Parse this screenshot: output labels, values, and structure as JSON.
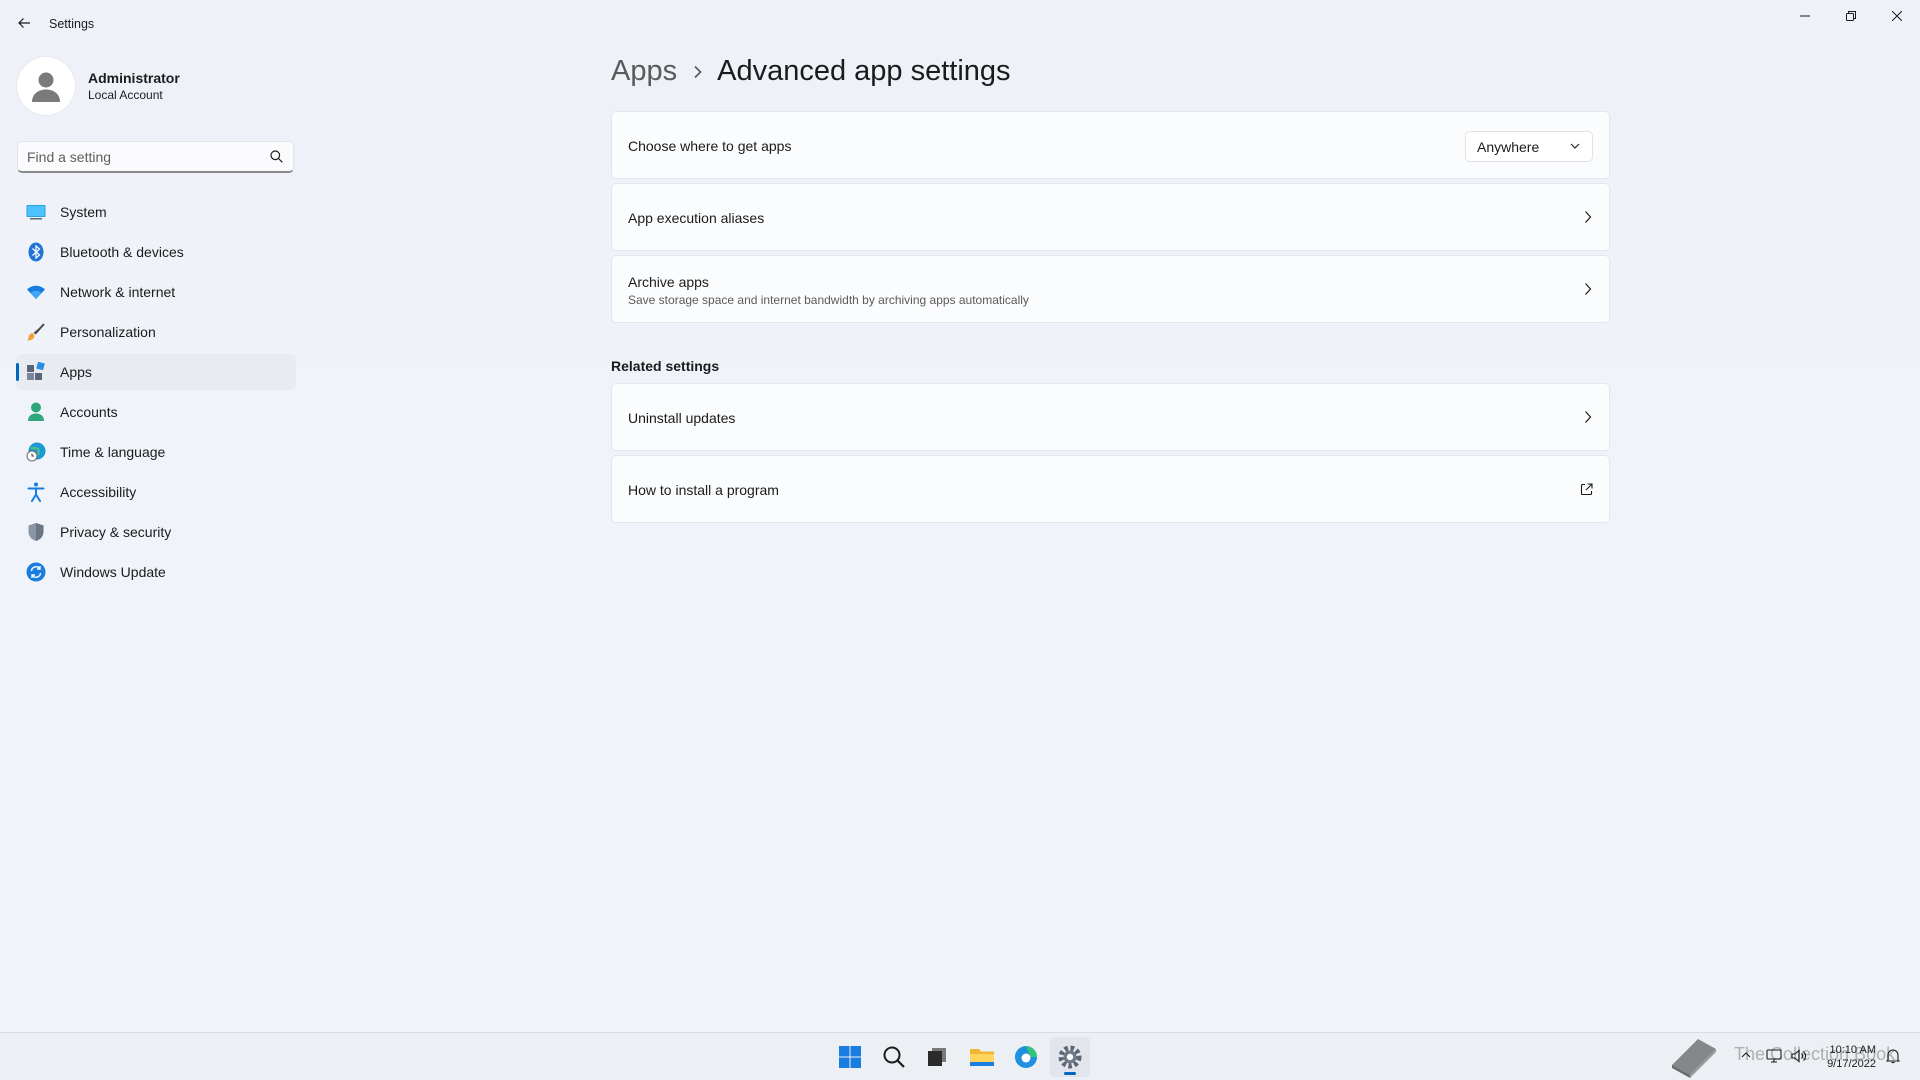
{
  "window": {
    "title": "Settings"
  },
  "profile": {
    "name": "Administrator",
    "account_type": "Local Account"
  },
  "search": {
    "placeholder": "Find a setting"
  },
  "nav": {
    "items": [
      {
        "label": "System",
        "icon": "system-icon"
      },
      {
        "label": "Bluetooth & devices",
        "icon": "bluetooth-icon"
      },
      {
        "label": "Network & internet",
        "icon": "wifi-icon"
      },
      {
        "label": "Personalization",
        "icon": "brush-icon"
      },
      {
        "label": "Apps",
        "icon": "apps-icon",
        "active": true
      },
      {
        "label": "Accounts",
        "icon": "person-icon"
      },
      {
        "label": "Time & language",
        "icon": "globe-clock-icon"
      },
      {
        "label": "Accessibility",
        "icon": "accessibility-icon"
      },
      {
        "label": "Privacy & security",
        "icon": "shield-icon"
      },
      {
        "label": "Windows Update",
        "icon": "update-icon"
      }
    ]
  },
  "breadcrumb": {
    "parent": "Apps",
    "current": "Advanced app settings"
  },
  "settings": {
    "choose_where": {
      "title": "Choose where to get apps",
      "value": "Anywhere"
    },
    "execution_aliases": {
      "title": "App execution aliases"
    },
    "archive_apps": {
      "title": "Archive apps",
      "subtitle": "Save storage space and internet bandwidth by archiving apps automatically"
    }
  },
  "related": {
    "heading": "Related settings",
    "uninstall_updates": "Uninstall updates",
    "how_to_install": "How to install a program"
  },
  "taskbar": {
    "apps": [
      "start-icon",
      "search-icon",
      "task-view-icon",
      "file-explorer-icon",
      "edge-icon",
      "settings-icon"
    ],
    "time": "10:10 AM",
    "date": "9/17/2022",
    "watermark": "The Collection Book"
  },
  "colors": {
    "accent": "#0067c0",
    "background": "#eef2f8",
    "card": "#fbfcfd"
  }
}
